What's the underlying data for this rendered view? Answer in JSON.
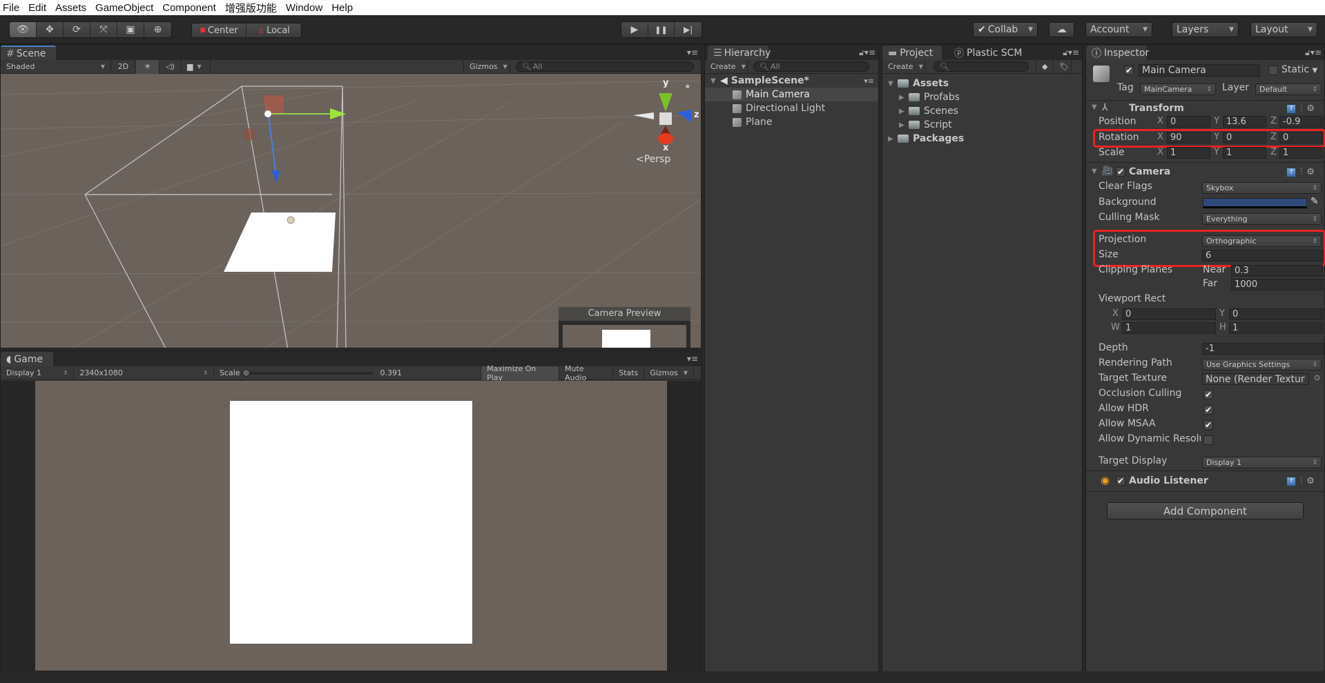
{
  "menu": [
    "File",
    "Edit",
    "Assets",
    "GameObject",
    "Component",
    "增强版功能",
    "Window",
    "Help"
  ],
  "toolbar": {
    "tools": [
      {
        "name": "view-tool",
        "glyph": "👁",
        "active": true
      },
      {
        "name": "move-tool",
        "glyph": "✥"
      },
      {
        "name": "rotate-tool",
        "glyph": "⟳"
      },
      {
        "name": "scale-tool",
        "glyph": "⤧"
      },
      {
        "name": "rect-tool",
        "glyph": "▣"
      },
      {
        "name": "transform-tool",
        "glyph": "⊕"
      }
    ],
    "pivot": "Center",
    "space": "Local",
    "play_glyph": "▶",
    "pause_glyph": "❚❚",
    "step_glyph": "▶|",
    "collab": "Collab",
    "account": "Account",
    "layers": "Layers",
    "layout": "Layout",
    "cloud_glyph": "☁"
  },
  "scene": {
    "tab": "Scene",
    "draw_mode": "Shaded",
    "mode_2d": "2D",
    "gizmos": "Gizmos",
    "search_placeholder": "All",
    "axis_y": "y",
    "axis_x": "x",
    "axis_z": "z",
    "projection_label": "Persp",
    "camera_preview_title": "Camera Preview"
  },
  "game": {
    "tab": "Game",
    "display": "Display 1",
    "resolution": "2340x1080",
    "scale_label": "Scale",
    "scale_value": "0.391",
    "scale_fraction": 0.0,
    "maximize": "Maximize On Play",
    "mute": "Mute Audio",
    "stats": "Stats",
    "gizmos": "Gizmos"
  },
  "hierarchy": {
    "tab": "Hierarchy",
    "create": "Create",
    "search_placeholder": "All",
    "scene_name": "SampleScene*",
    "items": [
      "Main Camera",
      "Directional Light",
      "Plane"
    ],
    "selected_index": 0
  },
  "project": {
    "tab": "Project",
    "tab2": "Plastic SCM",
    "create": "Create",
    "tree": [
      {
        "label": "Assets",
        "bold": true,
        "depth": 0,
        "expanded": true
      },
      {
        "label": "Profabs",
        "depth": 1
      },
      {
        "label": "Scenes",
        "depth": 1
      },
      {
        "label": "Script",
        "depth": 1
      },
      {
        "label": "Packages",
        "bold": true,
        "depth": 0,
        "expanded": false
      }
    ]
  },
  "inspector": {
    "tab": "Inspector",
    "object_name": "Main Camera",
    "active": true,
    "static_label": "Static",
    "static": false,
    "tag_label": "Tag",
    "tag": "MainCamera",
    "layer_label": "Layer",
    "layer": "Default",
    "transform": {
      "title": "Transform",
      "position_label": "Position",
      "rotation_label": "Rotation",
      "scale_label": "Scale",
      "position": {
        "x": "0",
        "y": "13.6",
        "z": "-0.9"
      },
      "rotation": {
        "x": "90",
        "y": "0",
        "z": "0"
      },
      "scale": {
        "x": "1",
        "y": "1",
        "z": "1"
      }
    },
    "camera": {
      "title": "Camera",
      "enabled": true,
      "clear_flags_label": "Clear Flags",
      "clear_flags": "Skybox",
      "background_label": "Background",
      "background_color": "#2f4a7a",
      "culling_mask_label": "Culling Mask",
      "culling_mask": "Everything",
      "projection_label": "Projection",
      "projection": "Orthographic",
      "size_label": "Size",
      "size": "6",
      "clipping_label": "Clipping Planes",
      "near_label": "Near",
      "near": "0.3",
      "far_label": "Far",
      "far": "1000",
      "viewport_label": "Viewport Rect",
      "viewport": {
        "x": "0",
        "y": "0",
        "w": "1",
        "h": "1"
      },
      "depth_label": "Depth",
      "depth": "-1",
      "rendering_path_label": "Rendering Path",
      "rendering_path": "Use Graphics Settings",
      "target_texture_label": "Target Texture",
      "target_texture": "None (Render Textur",
      "occlusion_label": "Occlusion Culling",
      "occlusion": true,
      "hdr_label": "Allow HDR",
      "hdr": true,
      "msaa_label": "Allow MSAA",
      "msaa": true,
      "dynres_label": "Allow Dynamic Resolu",
      "dynres": false,
      "target_display_label": "Target Display",
      "target_display": "Display 1"
    },
    "audio_listener": {
      "title": "Audio Listener",
      "enabled": true
    },
    "add_component": "Add Component"
  }
}
